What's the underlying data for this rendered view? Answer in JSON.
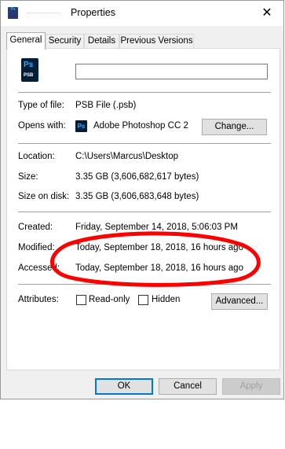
{
  "window": {
    "title": "Properties",
    "title_icon_text": "Ps"
  },
  "tabs": [
    {
      "label": "General"
    },
    {
      "label": "Security"
    },
    {
      "label": "Details"
    },
    {
      "label": "Previous Versions"
    }
  ],
  "general": {
    "file_icon": {
      "top_text": "Ps",
      "bottom_text": "PSB"
    },
    "name_value": "",
    "type_label": "Type of file:",
    "type_value": "PSB File (.psb)",
    "opens_label": "Opens with:",
    "opens_icon_text": "Ps",
    "opens_value": "Adobe Photoshop CC 2",
    "change_button": "Change...",
    "location_label": "Location:",
    "location_value": "C:\\Users\\Marcus\\Desktop",
    "size_label": "Size:",
    "size_value": "3.35 GB (3,606,682,617 bytes)",
    "size_on_disk_label": "Size on disk:",
    "size_on_disk_value": "3.35 GB (3,606,683,648 bytes)",
    "created_label": "Created:",
    "created_value": "Friday, September 14, 2018, 5:06:03 PM",
    "modified_label": "Modified:",
    "modified_value": "Today, September 18, 2018, 16 hours ago",
    "accessed_label": "Accessed:",
    "accessed_value": "Today, September 18, 2018, 16 hours ago",
    "attributes_label": "Attributes:",
    "readonly_label": "Read-only",
    "readonly_checked": false,
    "hidden_label": "Hidden",
    "hidden_checked": false,
    "advanced_button": "Advanced..."
  },
  "buttons": {
    "ok": "OK",
    "cancel": "Cancel",
    "apply": "Apply"
  },
  "annotation": {
    "color": "#ff0000"
  }
}
